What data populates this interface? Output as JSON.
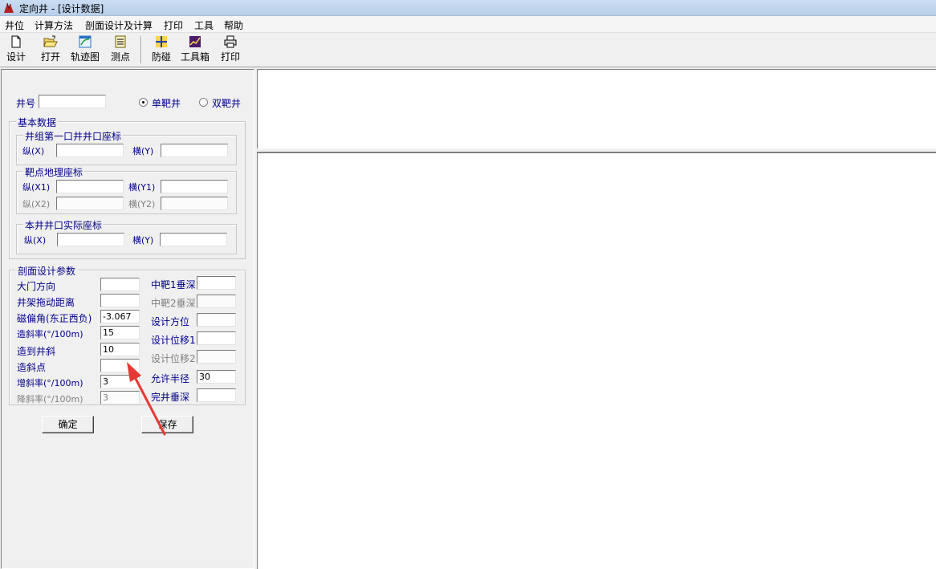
{
  "window": {
    "title": "定向井 - [设计数据]"
  },
  "menu": [
    "井位",
    "计算方法",
    "剖面设计及计算",
    "打印",
    "工具",
    "帮助"
  ],
  "toolbar": {
    "design": "设计",
    "open": "打开",
    "trajectory": "轨迹图",
    "survey": "测点",
    "anticollision": "防碰",
    "toolbox": "工具箱",
    "print": "打印"
  },
  "well": {
    "well_no_label": "井号",
    "well_no_value": "",
    "single_target": "单靶井",
    "double_target": "双靶井",
    "selected": "single"
  },
  "basic": {
    "title": "基本数据",
    "group1": {
      "title": "井组第一口井井口座标",
      "x_label": "纵(X)",
      "y_label": "横(Y)",
      "x_value": "",
      "y_value": ""
    },
    "group2": {
      "title": "靶点地理座标",
      "x1_label": "纵(X1)",
      "y1_label": "横(Y1)",
      "x2_label": "纵(X2)",
      "y2_label": "横(Y2)",
      "x1_value": "",
      "y1_value": "",
      "x2_value": "",
      "y2_value": ""
    },
    "group3": {
      "title": "本井井口实际座标",
      "x_label": "纵(X)",
      "y_label": "横(Y)",
      "x_value": "",
      "y_value": ""
    }
  },
  "profile": {
    "title": "剖面设计参数",
    "gate_direction": {
      "label": "大门方向",
      "value": ""
    },
    "rig_offset": {
      "label": "井架拖动距离",
      "value": ""
    },
    "mag_decl": {
      "label": "磁偏角(东正西负)",
      "value": "-3.067"
    },
    "build_rate": {
      "label": "造斜率(°/100m)",
      "value": "15"
    },
    "target_incl": {
      "label": "造到井斜",
      "value": "10"
    },
    "kickoff": {
      "label": "造斜点",
      "value": ""
    },
    "increase_rate": {
      "label": "增斜率(°/100m)",
      "value": "3"
    },
    "drop_rate": {
      "label": "降斜率(°/100m)",
      "value": "3"
    },
    "t1_tvd": {
      "label": "中靶1垂深",
      "value": ""
    },
    "t2_tvd": {
      "label": "中靶2垂深",
      "value": ""
    },
    "design_azimuth": {
      "label": "设计方位",
      "value": ""
    },
    "design_disp1": {
      "label": "设计位移1",
      "value": ""
    },
    "design_disp2": {
      "label": "设计位移2",
      "value": ""
    },
    "allowed_radius": {
      "label": "允许半径",
      "value": "30"
    },
    "final_tvd": {
      "label": "完井垂深",
      "value": ""
    }
  },
  "buttons": {
    "confirm": "确定",
    "save": "保存"
  },
  "colors": {
    "title_bar": "#c9dcf3",
    "label_blue": "#00008b",
    "arrow": "#e53935"
  }
}
